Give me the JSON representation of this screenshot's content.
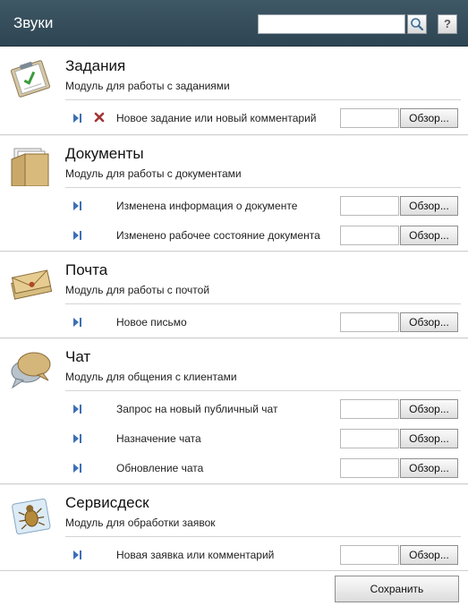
{
  "window": {
    "title": "Звуки"
  },
  "search": {
    "placeholder": "",
    "value": ""
  },
  "help_label": "?",
  "browse_label": "Обзор...",
  "save_label": "Сохранить",
  "modules": [
    {
      "title": "Задания",
      "description": "Модуль для работы с заданиями",
      "icon": "clipboard-checklist-icon",
      "events": [
        {
          "label": "Новое задание или новый комментарий",
          "has_remove": true,
          "file": ""
        }
      ]
    },
    {
      "title": "Документы",
      "description": "Модуль для работы с документами",
      "icon": "folder-documents-icon",
      "events": [
        {
          "label": "Изменена информация о документе",
          "has_remove": false,
          "file": ""
        },
        {
          "label": "Изменено рабочее состояние документа",
          "has_remove": false,
          "file": ""
        }
      ]
    },
    {
      "title": "Почта",
      "description": "Модуль для работы с почтой",
      "icon": "envelopes-icon",
      "events": [
        {
          "label": "Новое письмо",
          "has_remove": false,
          "file": ""
        }
      ]
    },
    {
      "title": "Чат",
      "description": "Модуль для общения с клиентами",
      "icon": "chat-bubbles-icon",
      "events": [
        {
          "label": "Запрос на новый публичный чат",
          "has_remove": false,
          "file": ""
        },
        {
          "label": "Назначение чата",
          "has_remove": false,
          "file": ""
        },
        {
          "label": "Обновление чата",
          "has_remove": false,
          "file": ""
        }
      ]
    },
    {
      "title": "Сервисдеск",
      "description": "Модуль для обработки заявок",
      "icon": "bug-box-icon",
      "events": [
        {
          "label": "Новая заявка или комментарий",
          "has_remove": false,
          "file": ""
        }
      ]
    }
  ]
}
